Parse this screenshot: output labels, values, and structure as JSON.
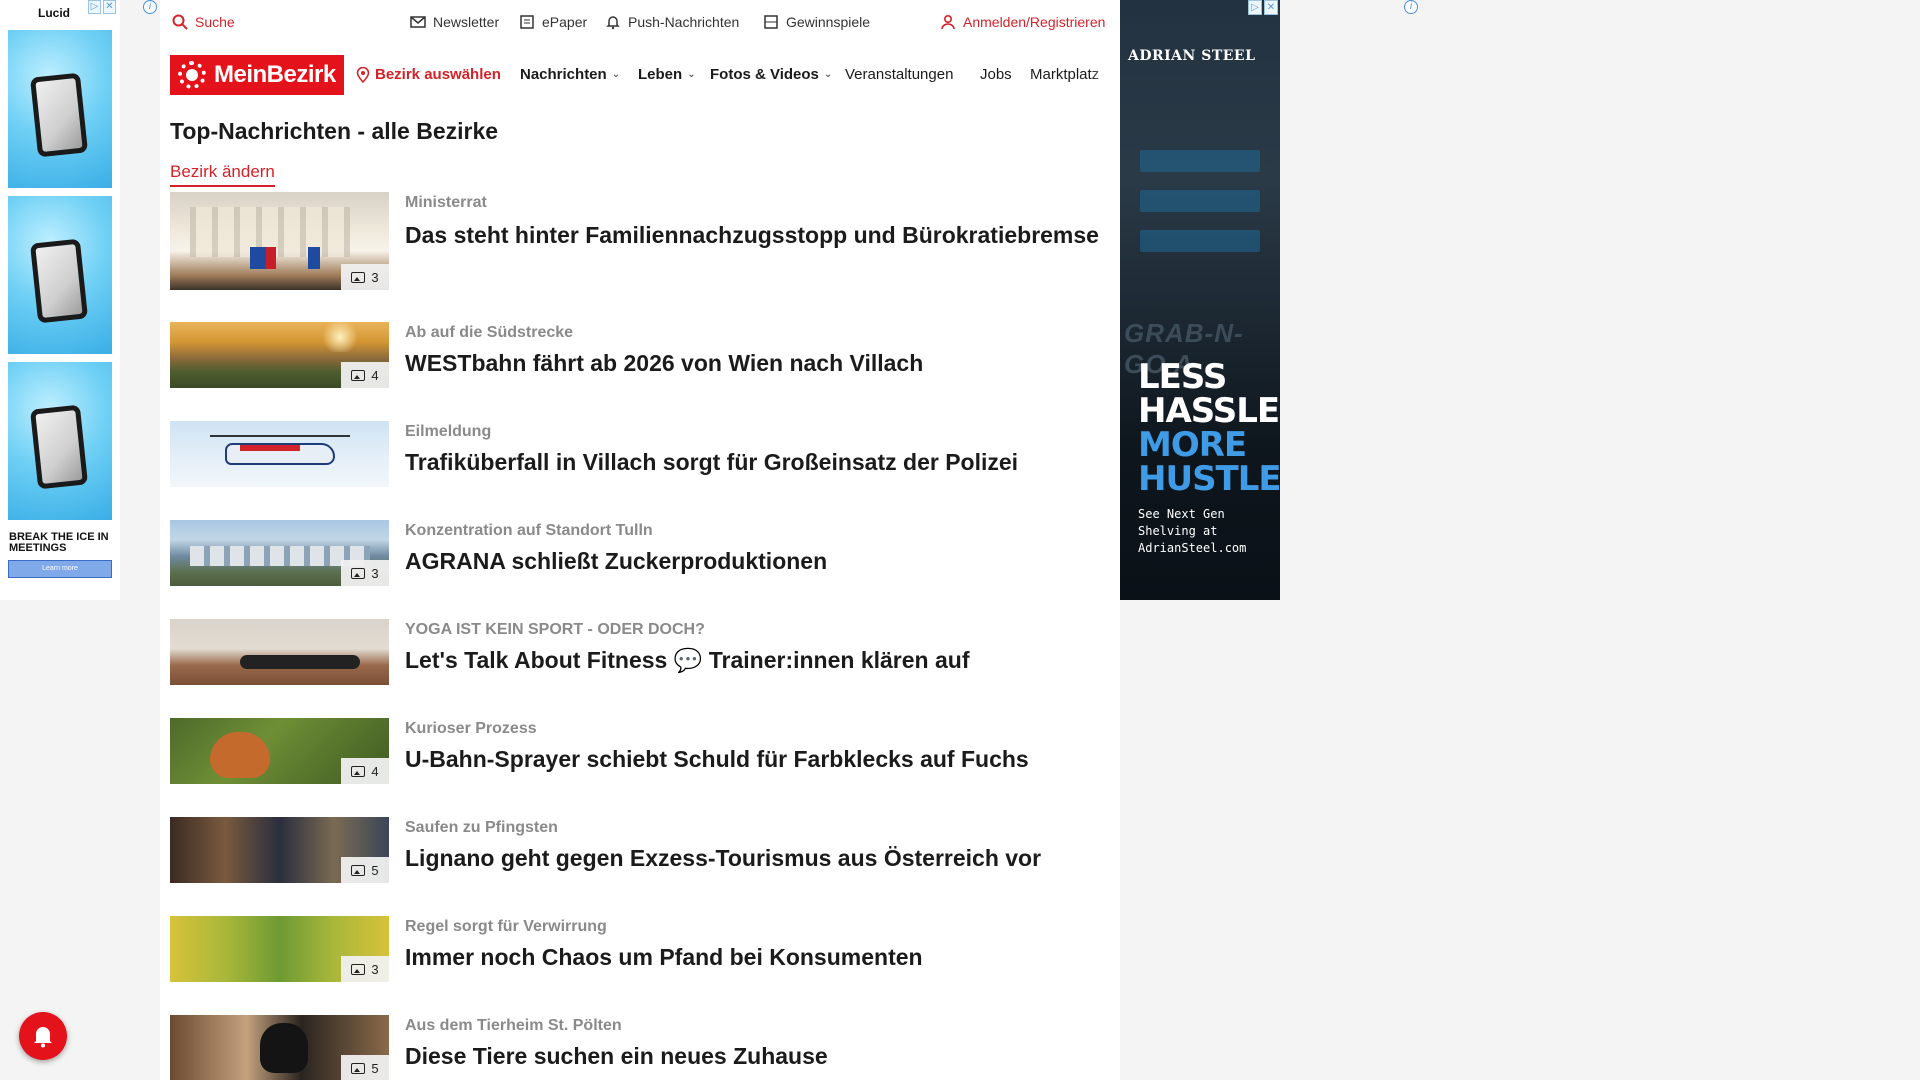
{
  "ad_left": {
    "brand": "Lucid",
    "tagline": "BREAK THE ICE IN MEETINGS",
    "cta": "Learn more",
    "info": "i"
  },
  "topbar": {
    "search": "Suche",
    "newsletter": "Newsletter",
    "epaper": "ePaper",
    "push": "Push-Nachrichten",
    "gewinnspiele": "Gewinnspiele",
    "login": "Anmelden/Registrieren"
  },
  "nav": {
    "logo": "MeinBezirk",
    "district": "Bezirk auswählen",
    "items": [
      "Nachrichten",
      "Leben",
      "Fotos & Videos",
      "Veranstaltungen",
      "Jobs",
      "Marktplatz"
    ]
  },
  "main": {
    "title": "Top-Nachrichten - alle Bezirke",
    "change_district": "Bezirk ändern"
  },
  "articles": [
    {
      "kicker": "Ministerrat",
      "headline": "Das steht hinter Familiennachzugsstopp und Bürokratiebremse",
      "count": "3"
    },
    {
      "kicker": "Ab auf die Südstrecke",
      "headline": "WESTbahn fährt ab 2026 von Wien nach Villach",
      "count": "4"
    },
    {
      "kicker": "Eilmeldung",
      "headline": "Trafiküberfall in Villach sorgt für Großeinsatz der Polizei",
      "count": ""
    },
    {
      "kicker": "Konzentration auf Standort Tulln",
      "headline": "AGRANA schließt Zuckerproduktionen",
      "count": "3"
    },
    {
      "kicker": "YOGA IST KEIN SPORT - ODER DOCH?",
      "headline": "Let's Talk About Fitness 💬 Trainer:innen klären auf",
      "count": ""
    },
    {
      "kicker": "Kurioser Prozess",
      "headline": "U-Bahn-Sprayer schiebt Schuld für Farbklecks auf Fuchs",
      "count": "4"
    },
    {
      "kicker": "Saufen zu Pfingsten",
      "headline": "Lignano geht gegen Exzess-Tourismus aus Österreich vor",
      "count": "5"
    },
    {
      "kicker": "Regel sorgt für Verwirrung",
      "headline": "Immer noch Chaos um Pfand bei Konsumenten",
      "count": "3"
    },
    {
      "kicker": "Aus dem Tierheim St. Pölten",
      "headline": "Diese Tiere suchen ein neues Zuhause",
      "count": "5"
    }
  ],
  "ad_right": {
    "brand": "ADRIAN STEEL",
    "bg_text": "GRAB-N-GO A",
    "line1": "LESS HASSLE,",
    "line2": "MORE HUSTLE",
    "sub": "See Next Gen Shelving at AdrianSteel.com"
  },
  "colors": {
    "brand_red": "#e3121b",
    "link_red": "#d3232a",
    "kicker_gray": "#8a8a8a",
    "ad_blue": "#3f9be6"
  }
}
